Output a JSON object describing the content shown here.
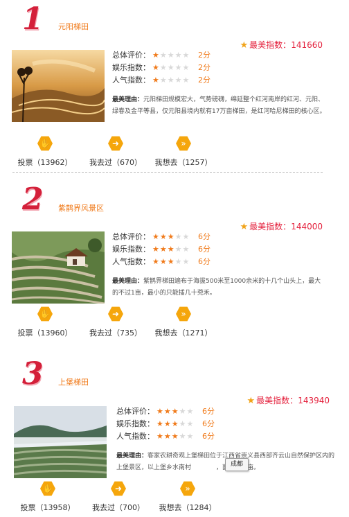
{
  "entries": [
    {
      "rank": "1",
      "name": "元阳梯田",
      "index_label": "最美指数：",
      "index_value": "141660",
      "ratings": [
        {
          "label": "总体评价：",
          "stars": 1,
          "score": "2分"
        },
        {
          "label": "娱乐指数：",
          "stars": 1,
          "score": "2分"
        },
        {
          "label": "人气指数：",
          "stars": 1,
          "score": "2分"
        }
      ],
      "reason_label": "最美理由：",
      "reason_text": "元阳梯田规模宏大，气势磅礴，绵延整个红河南岸的红河、元阳、绿春及金平等县，仅元阳县境内就有17万亩梯田，是红河哈尼梯田的核心区。",
      "actions": [
        {
          "icon": "vote-icon",
          "label": "投票（13962）"
        },
        {
          "icon": "arrow-right-icon",
          "label": "我去过（670）"
        },
        {
          "icon": "double-arrow-icon",
          "label": "我想去（1257）"
        }
      ]
    },
    {
      "rank": "2",
      "name": "紫鹊界风景区",
      "index_label": "最美指数：",
      "index_value": "144000",
      "ratings": [
        {
          "label": "总体评价：",
          "stars": 3,
          "score": "6分"
        },
        {
          "label": "娱乐指数：",
          "stars": 3,
          "score": "6分"
        },
        {
          "label": "人气指数：",
          "stars": 3,
          "score": "6分"
        }
      ],
      "reason_label": "最美理由：",
      "reason_text": "紫鹊界梯田遍布于海拔500米至1000余米的十几个山头上，最大的不过1亩，最小的只能插几十蔸禾。",
      "actions": [
        {
          "icon": "vote-icon",
          "label": "投票（13960）"
        },
        {
          "icon": "arrow-right-icon",
          "label": "我去过（735）"
        },
        {
          "icon": "double-arrow-icon",
          "label": "我想去（1271）"
        }
      ]
    },
    {
      "rank": "3",
      "name": "上堡梯田",
      "index_label": "最美指数：",
      "index_value": "143940",
      "ratings": [
        {
          "label": "总体评价：",
          "stars": 3,
          "score": "6分"
        },
        {
          "label": "娱乐指数：",
          "stars": 3,
          "score": "6分"
        },
        {
          "label": "人气指数：",
          "stars": 3,
          "score": "6分"
        }
      ],
      "reason_label": "最美理由：",
      "reason_text": "客家农耕奇观上堡梯田位于江西省崇义县西部齐云山自然保护区内的上堡景区，以上堡乡水南村",
      "reason_tail": "，面积近万亩。",
      "actions": [
        {
          "icon": "vote-icon",
          "label": "投票（13958）"
        },
        {
          "icon": "arrow-right-icon",
          "label": "我去过（700）"
        },
        {
          "icon": "double-arrow-icon",
          "label": "我想去（1284）"
        }
      ]
    }
  ],
  "tooltip": "成都",
  "colors": {
    "rank": "#d4203a",
    "name": "#f07a1a",
    "index": "#e4203c",
    "action_icon": "#f5a60c"
  }
}
